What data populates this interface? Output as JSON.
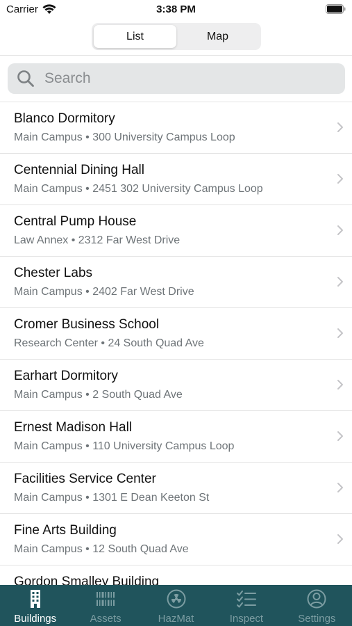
{
  "status": {
    "carrier": "Carrier",
    "time": "3:38 PM"
  },
  "segment": {
    "options": [
      {
        "label": "List",
        "active": true
      },
      {
        "label": "Map",
        "active": false
      }
    ]
  },
  "search": {
    "placeholder": "Search"
  },
  "buildings": [
    {
      "name": "Blanco Dormitory",
      "detail": "Main Campus • 300 University Campus Loop"
    },
    {
      "name": "Centennial Dining Hall",
      "detail": "Main Campus • 2451 302 University Campus Loop"
    },
    {
      "name": "Central Pump House",
      "detail": "Law Annex • 2312 Far West Drive"
    },
    {
      "name": "Chester Labs",
      "detail": "Main Campus • 2402 Far West Drive"
    },
    {
      "name": "Cromer Business School",
      "detail": "Research Center • 24 South Quad Ave"
    },
    {
      "name": "Earhart Dormitory",
      "detail": "Main Campus • 2 South Quad Ave"
    },
    {
      "name": "Ernest Madison Hall",
      "detail": "Main Campus • 110 University Campus Loop"
    },
    {
      "name": "Facilities Service Center",
      "detail": "Main Campus • 1301 E Dean Keeton St"
    },
    {
      "name": "Fine Arts Building",
      "detail": "Main Campus • 12 South Quad Ave"
    },
    {
      "name": "Gordon Smalley Building",
      "detail": ""
    }
  ],
  "tabs": [
    {
      "label": "Buildings",
      "icon": "building-icon",
      "active": true
    },
    {
      "label": "Assets",
      "icon": "barcode-icon",
      "active": false
    },
    {
      "label": "HazMat",
      "icon": "radiation-icon",
      "active": false
    },
    {
      "label": "Inspect",
      "icon": "checklist-icon",
      "active": false
    },
    {
      "label": "Settings",
      "icon": "person-circle-icon",
      "active": false
    }
  ],
  "colors": {
    "tabbar": "#20545c",
    "tab_active": "#ffffff",
    "tab_inactive": "#7c9da2",
    "subtitle": "#6e7478"
  }
}
